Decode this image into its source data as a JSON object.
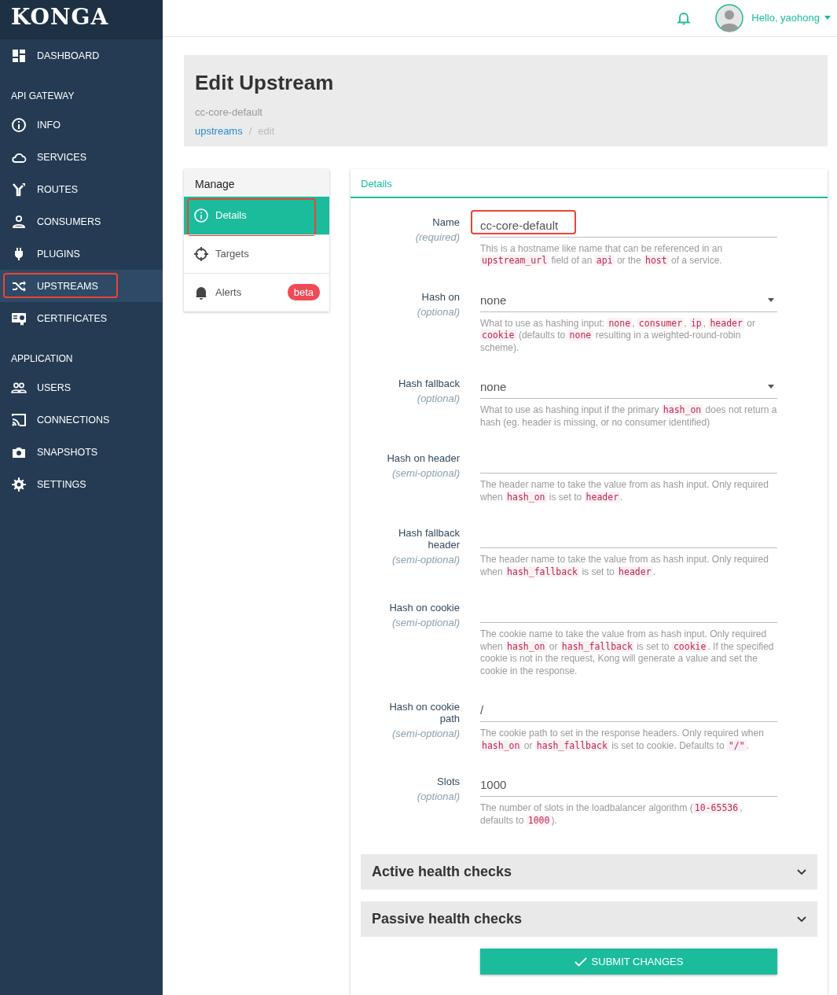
{
  "brand": "KONGA",
  "header": {
    "greeting": "Hello, yaohong"
  },
  "sidebar": {
    "items": [
      {
        "kind": "link",
        "label": "DASHBOARD",
        "selected": false,
        "annotated": false
      },
      {
        "kind": "heading",
        "label": "API GATEWAY"
      },
      {
        "kind": "link",
        "label": "INFO",
        "selected": false,
        "annotated": false
      },
      {
        "kind": "link",
        "label": "SERVICES",
        "selected": false,
        "annotated": false
      },
      {
        "kind": "link",
        "label": "ROUTES",
        "selected": false,
        "annotated": false
      },
      {
        "kind": "link",
        "label": "CONSUMERS",
        "selected": false,
        "annotated": false
      },
      {
        "kind": "link",
        "label": "PLUGINS",
        "selected": false,
        "annotated": false
      },
      {
        "kind": "link",
        "label": "UPSTREAMS",
        "selected": true,
        "annotated": true
      },
      {
        "kind": "link",
        "label": "CERTIFICATES",
        "selected": false,
        "annotated": false
      },
      {
        "kind": "heading",
        "label": "APPLICATION"
      },
      {
        "kind": "link",
        "label": "USERS",
        "selected": false,
        "annotated": false
      },
      {
        "kind": "link",
        "label": "CONNECTIONS",
        "selected": false,
        "annotated": false
      },
      {
        "kind": "link",
        "label": "SNAPSHOTS",
        "selected": false,
        "annotated": false
      },
      {
        "kind": "link",
        "label": "SETTINGS",
        "selected": false,
        "annotated": false
      }
    ]
  },
  "page": {
    "title": "Edit Upstream",
    "subtitle": "cc-core-default",
    "breadcrumb_separator": "/",
    "breadcrumb": [
      {
        "label": "upstreams",
        "kind": "link"
      },
      {
        "label": "edit",
        "kind": "current"
      }
    ]
  },
  "manage": {
    "title": "Manage",
    "items": [
      {
        "label": "Details",
        "selected": true,
        "annotated": true
      },
      {
        "label": "Targets",
        "selected": false,
        "annotated": false
      },
      {
        "label": "Alerts",
        "selected": false,
        "annotated": false,
        "badge": "beta"
      }
    ]
  },
  "details": {
    "tab": "Details",
    "fields": [
      {
        "kind": "input",
        "label": "Name",
        "note": "(required)",
        "value": "cc-core-default",
        "annotated": true,
        "help": [
          {
            "kind": "text",
            "text": "This is a hostname like name that can be referenced in an "
          },
          {
            "kind": "code",
            "text": "upstream_url"
          },
          {
            "kind": "text",
            "text": " field of an "
          },
          {
            "kind": "code",
            "text": "api"
          },
          {
            "kind": "text",
            "text": " or the "
          },
          {
            "kind": "code",
            "text": "host"
          },
          {
            "kind": "text",
            "text": " of a service."
          }
        ]
      },
      {
        "kind": "select",
        "label": "Hash on",
        "note": "(optional)",
        "value": "none",
        "annotated": false,
        "help": [
          {
            "kind": "text",
            "text": "What to use as hashing input: "
          },
          {
            "kind": "code",
            "text": "none"
          },
          {
            "kind": "text",
            "text": ", "
          },
          {
            "kind": "code",
            "text": "consumer"
          },
          {
            "kind": "text",
            "text": ", "
          },
          {
            "kind": "code",
            "text": "ip"
          },
          {
            "kind": "text",
            "text": ", "
          },
          {
            "kind": "code",
            "text": "header"
          },
          {
            "kind": "text",
            "text": " or "
          },
          {
            "kind": "code",
            "text": "cookie"
          },
          {
            "kind": "text",
            "text": " (defaults to "
          },
          {
            "kind": "code",
            "text": "none"
          },
          {
            "kind": "text",
            "text": " resulting in a weighted-round-robin scheme)."
          }
        ]
      },
      {
        "kind": "select",
        "label": "Hash fallback",
        "note": "(optional)",
        "value": "none",
        "annotated": false,
        "help": [
          {
            "kind": "text",
            "text": "What to use as hashing input if the primary "
          },
          {
            "kind": "code",
            "text": "hash_on"
          },
          {
            "kind": "text",
            "text": " does not return a hash (eg. header is missing, or no consumer identified)"
          }
        ]
      },
      {
        "kind": "input",
        "label": "Hash on header",
        "note": "(semi-optional)",
        "annotated": false,
        "help": [
          {
            "kind": "text",
            "text": "The header name to take the value from as hash input. Only required when "
          },
          {
            "kind": "code",
            "text": "hash_on"
          },
          {
            "kind": "text",
            "text": " is set to "
          },
          {
            "kind": "code",
            "text": "header"
          },
          {
            "kind": "text",
            "text": "."
          }
        ]
      },
      {
        "kind": "input",
        "label": "Hash fallback header",
        "note": "(semi-optional)",
        "annotated": false,
        "help": [
          {
            "kind": "text",
            "text": "The header name to take the value from as hash input. Only required when "
          },
          {
            "kind": "code",
            "text": "hash_fallback"
          },
          {
            "kind": "text",
            "text": " is set to "
          },
          {
            "kind": "code",
            "text": "header"
          },
          {
            "kind": "text",
            "text": "."
          }
        ]
      },
      {
        "kind": "input",
        "label": "Hash on cookie",
        "note": "(semi-optional)",
        "annotated": false,
        "help": [
          {
            "kind": "text",
            "text": "The cookie name to take the value from as hash input. Only required when "
          },
          {
            "kind": "code",
            "text": "hash_on"
          },
          {
            "kind": "text",
            "text": " or "
          },
          {
            "kind": "code",
            "text": "hash_fallback"
          },
          {
            "kind": "text",
            "text": " is set to "
          },
          {
            "kind": "code",
            "text": "cookie"
          },
          {
            "kind": "text",
            "text": ". If the specified cookie is not in the request, Kong will generate a value and set the cookie in the response."
          }
        ]
      },
      {
        "kind": "input",
        "label": "Hash on cookie path",
        "note": "(semi-optional)",
        "value": "/",
        "annotated": false,
        "help": [
          {
            "kind": "text",
            "text": "The cookie path to set in the response headers. Only required when "
          },
          {
            "kind": "code",
            "text": "hash_on"
          },
          {
            "kind": "text",
            "text": " or "
          },
          {
            "kind": "code",
            "text": "hash_fallback"
          },
          {
            "kind": "text",
            "text": " is set to cookie. Defaults to "
          },
          {
            "kind": "code",
            "text": "\"/\""
          },
          {
            "kind": "text",
            "text": "."
          }
        ]
      },
      {
        "kind": "input",
        "label": "Slots",
        "note": "(optional)",
        "value": "1000",
        "annotated": false,
        "help": [
          {
            "kind": "text",
            "text": "The number of slots in the loadbalancer algorithm ("
          },
          {
            "kind": "code",
            "text": "10-65536"
          },
          {
            "kind": "text",
            "text": ", defaults to "
          },
          {
            "kind": "code",
            "text": "1000"
          },
          {
            "kind": "text",
            "text": ")."
          }
        ]
      }
    ],
    "sections": [
      {
        "title": "Active health checks",
        "expanded": false
      },
      {
        "title": "Passive health checks",
        "expanded": false
      }
    ],
    "submit": "SUBMIT CHANGES"
  }
}
